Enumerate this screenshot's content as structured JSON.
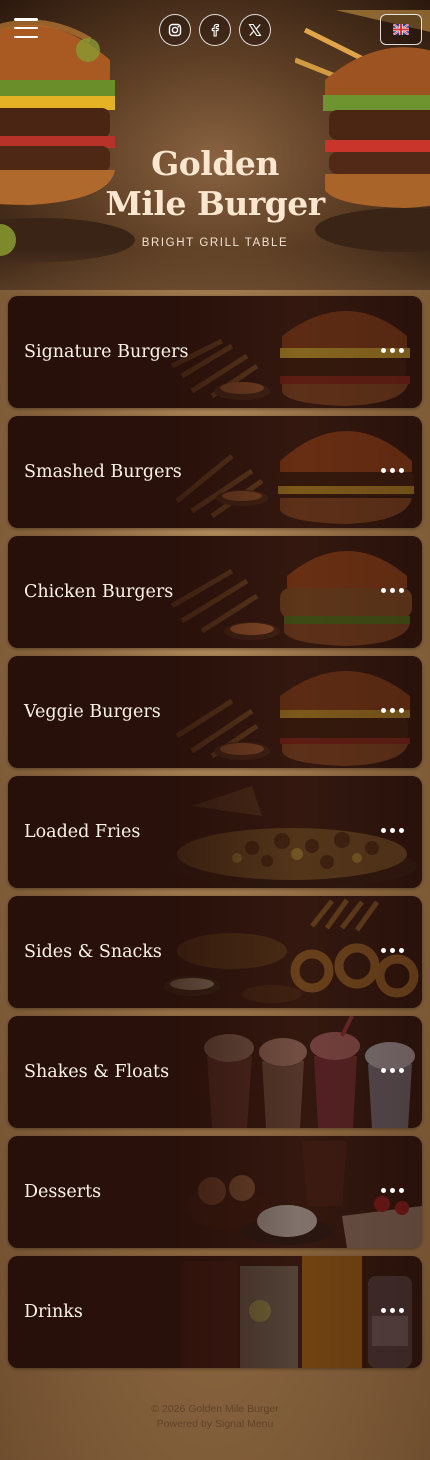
{
  "header": {
    "menu_icon": "hamburger-menu-icon",
    "socials": [
      {
        "name": "instagram",
        "icon": "instagram-icon"
      },
      {
        "name": "facebook",
        "icon": "facebook-icon"
      },
      {
        "name": "x",
        "icon": "x-twitter-icon"
      }
    ],
    "language_flag": "uk-flag-icon"
  },
  "brand": {
    "title_line1": "Golden",
    "title_line2": "Mile Burger",
    "tagline": "BRIGHT GRILL TABLE"
  },
  "categories": [
    {
      "label": "Signature Burgers",
      "art": "burger-fries"
    },
    {
      "label": "Smashed Burgers",
      "art": "burger-fries"
    },
    {
      "label": "Chicken Burgers",
      "art": "burger-fries"
    },
    {
      "label": "Veggie Burgers",
      "art": "burger-fries"
    },
    {
      "label": "Loaded Fries",
      "art": "loaded-fries"
    },
    {
      "label": "Sides & Snacks",
      "art": "onion-rings"
    },
    {
      "label": "Shakes & Floats",
      "art": "shakes"
    },
    {
      "label": "Desserts",
      "art": "desserts"
    },
    {
      "label": "Drinks",
      "art": "drinks"
    }
  ],
  "footer": {
    "copyright": "2026 Golden Mile Burger",
    "powered_by": "Powered by Signal Menu"
  },
  "colors": {
    "card": "#2c130d",
    "title": "#fbe6cf",
    "page": "#8f6a42"
  }
}
